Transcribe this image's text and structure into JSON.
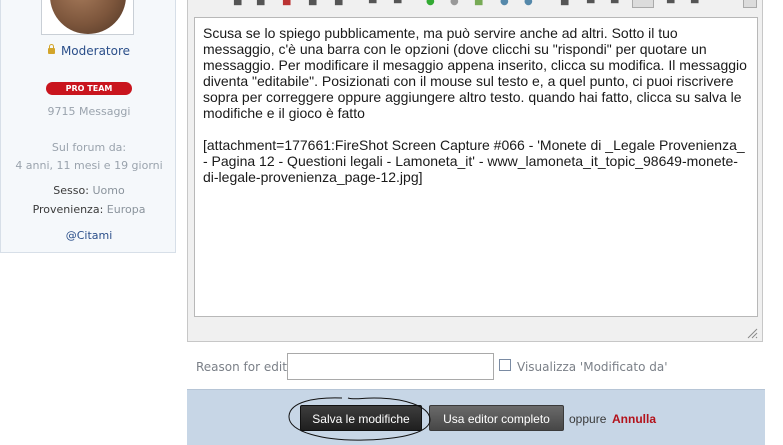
{
  "user": {
    "role": "Moderatore",
    "badge": "PRO TEAM",
    "messages": "9715 Messaggi",
    "since_label": "Sul forum da:",
    "since_value": "4 anni, 11 mesi e 19 giorni",
    "sex_label": "Sesso:",
    "sex_value": "Uomo",
    "origin_label": "Provenienza:",
    "origin_value": "Europa",
    "cite": "@Citami"
  },
  "editor": {
    "text": "Scusa se lo spiego pubblicamente, ma può servire anche ad altri. Sotto il tuo messaggio, c'è una barra con le opzioni (dove clicchi su \"rispondi\" per quotare un messaggio. Per modificare il mesaggio appena inserito, clicca su modifica. Il messaggio diventa \"editabile\". Posizionati con il mouse sul testo e, a quel punto, ci puoi riscrivere sopra per correggere oppure aggiungere altro testo. quando hai fatto, clicca su salva le modifiche e il gioco è fatto\n\n[attachment=177661:FireShot Screen Capture #066 - 'Monete di _Legale Provenienza_ - Pagina 12 - Questioni legali - Lamoneta_it' - www_lamoneta_it_topic_98649-monete-di-legale-provenienza_page-12.jpg]"
  },
  "reason": {
    "label": "Reason for edit:",
    "value": "",
    "checkbox_label": "Visualizza 'Modificato da'"
  },
  "actions": {
    "save": "Salva le modifiche",
    "full_editor": "Usa editor completo",
    "or": "oppure",
    "cancel": "Annulla"
  },
  "colors": {
    "accent_link": "#2b4f8a",
    "badge_red": "#c9151e",
    "cancel_red": "#b3121b",
    "button_bar": "#c7d6e6"
  }
}
